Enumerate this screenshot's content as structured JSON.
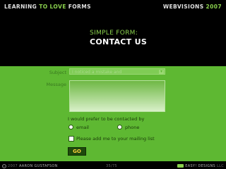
{
  "header": {
    "left_1": "LEARNING ",
    "left_2": "TO LOVE",
    "left_3": " FORMS",
    "right_1": "WEBVISIONS ",
    "right_2": "2007"
  },
  "slide": {
    "subtitle": "SIMPLE FORM:",
    "title": "CONTACT US"
  },
  "form": {
    "subject_label": "Subject",
    "subject_value": "I noticed a mistake and",
    "message_label": "Message",
    "prompt": "I would prefer to be contacted by",
    "options": [
      "email",
      "phone"
    ],
    "mailing_list": "Please add me to your mailing list",
    "submit": "GO"
  },
  "footer": {
    "year": "2007",
    "author": "AARON GUSTAFSON",
    "page": "35/75",
    "company": "EASY! DESIGNS",
    "suffix": "LLC"
  },
  "colors": {
    "accent": "#8ad14d",
    "panel": "#5eb832",
    "button_text": "#ffd23a"
  }
}
